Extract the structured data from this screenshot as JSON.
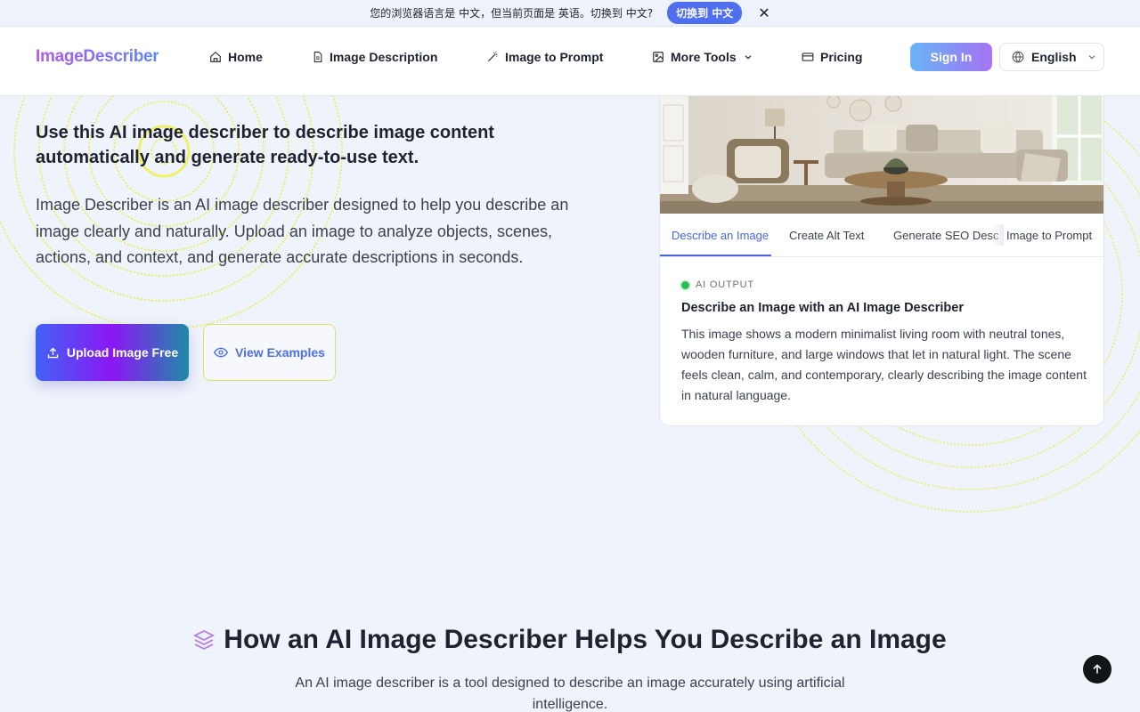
{
  "banner": {
    "message": "您的浏览器语言是 中文，但当前页面是 英语。切换到 中文?",
    "switch_label": "切换到 中文",
    "close_symbol": "✕"
  },
  "header": {
    "logo": "ImageDescriber",
    "nav": [
      {
        "label": "Home",
        "icon": "home-icon"
      },
      {
        "label": "Image Description",
        "icon": "document-icon"
      },
      {
        "label": "Image to Prompt",
        "icon": "magic-wand-icon"
      },
      {
        "label": "More Tools",
        "icon": "image-icon"
      },
      {
        "label": "Pricing",
        "icon": "card-icon"
      }
    ],
    "signin_label": "Sign In",
    "language": "English"
  },
  "hero": {
    "heading": "Use this AI image describer to describe image content automatically and generate ready-to-use text.",
    "description": "Image Describer is an AI image describer designed to help you describe an image clearly and naturally. Upload an image to analyze objects, scenes, actions, and context, and generate accurate descriptions in seconds.",
    "upload_label": "Upload Image Free",
    "examples_label": "View Examples"
  },
  "card": {
    "tabs": [
      "Describe an Image",
      "Create Alt Text",
      "Generate SEO Desc",
      "Image to Prompt"
    ],
    "active_tab": 0,
    "output_label": "AI OUTPUT",
    "output_title": "Describe an Image with an AI Image Describer",
    "output_text": "This image shows a modern minimalist living room with neutral tones, wooden furniture, and large windows that let in natural light. The scene feels clean, calm, and contemporary, clearly describing the image content in natural language."
  },
  "section": {
    "title": "How an AI Image Describer Helps You Describe an Image",
    "subtitle": "An AI image describer is a tool designed to describe an image accurately using artificial intelligence."
  },
  "colors": {
    "accent": "#4866e0",
    "background": "#eff3fb",
    "status_dot": "#2bbd55"
  }
}
